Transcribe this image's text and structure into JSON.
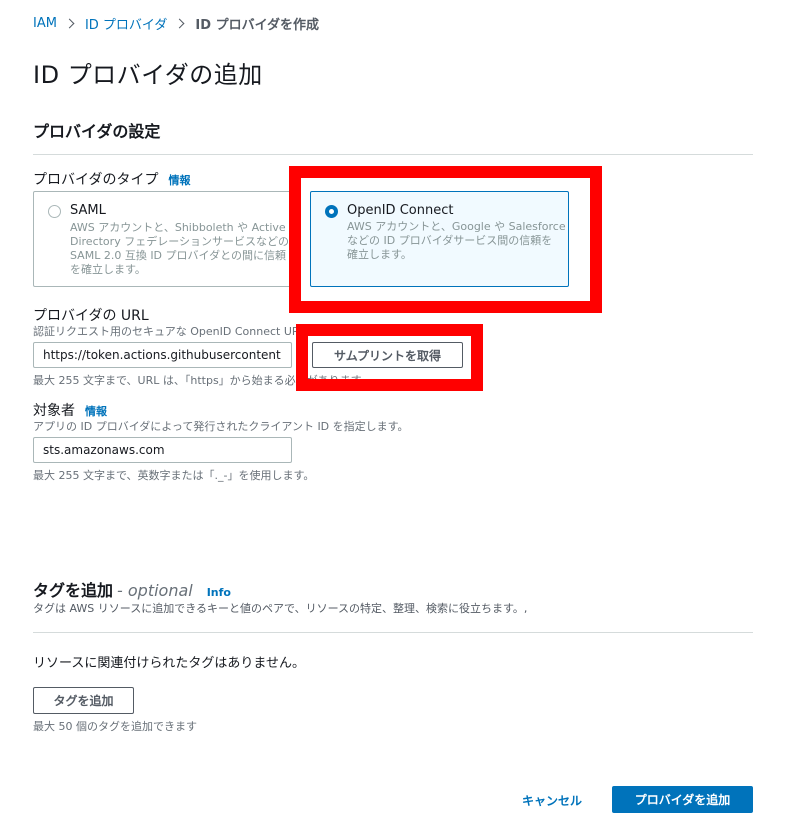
{
  "breadcrumb": {
    "items": [
      "IAM",
      "ID プロバイダ",
      "ID プロバイダを作成"
    ]
  },
  "page_title": "ID プロバイダの追加",
  "provider_settings": {
    "title": "プロバイダの設定",
    "type_label": "プロバイダのタイプ",
    "info": "情報",
    "options": [
      {
        "title": "SAML",
        "description": [
          "AWS アカウントと、Shibboleth や Active",
          "Directory フェデレーションサービスなどの",
          "SAML 2.0 互換 ID プロバイダとの間に信頼",
          "を確立します。"
        ],
        "selected": false
      },
      {
        "title": "OpenID Connect",
        "description": [
          "AWS アカウントと、Google や Salesforce",
          "などの ID プロバイダサービス間の信頼を",
          "確立します。"
        ],
        "selected": true
      }
    ]
  },
  "provider_url": {
    "label": "プロバイダの URL",
    "description": "認証リクエスト用のセキュアな OpenID Connect URL を",
    "value": "https://token.actions.githubusercontent.com",
    "constraint": "最大 255 文字まで、URL は、「https」から始まる必要があります。",
    "thumbprint_button": "サムプリントを取得"
  },
  "audience": {
    "label": "対象者",
    "info": "情報",
    "description": "アプリの ID プロバイダによって発行されたクライアント ID を指定します。",
    "value": "sts.amazonaws.com",
    "constraint": "最大 255 文字まで、英数字または「._-」を使用します。"
  },
  "tags": {
    "title": "タグを追加",
    "optional": "- optional",
    "info": "Info",
    "description": "タグは AWS リソースに追加できるキーと値のペアで、リソースの特定、整理、検索に役立ちます。,",
    "empty_message": "リソースに関連付けられたタグはありません。",
    "add_button": "タグを追加",
    "limit": "最大 50 個のタグを追加できます"
  },
  "footer": {
    "cancel": "キャンセル",
    "submit": "プロバイダを追加"
  },
  "colors": {
    "accent": "#0073bb",
    "highlight": "#ff0000"
  }
}
